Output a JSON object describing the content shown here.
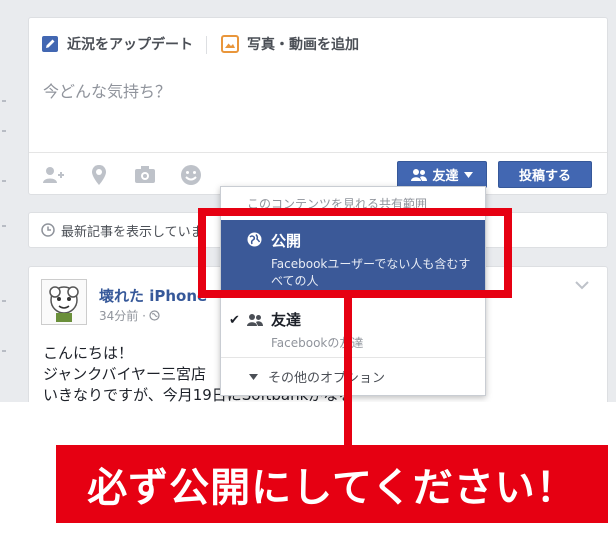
{
  "composer": {
    "tab_status": "近況をアップデート",
    "tab_photo": "写真・動画を追加",
    "placeholder": "今どんな気持ち？",
    "friends_button": "友達",
    "post_button": "投稿する"
  },
  "news_bar": {
    "text": "最新記事を表示していま"
  },
  "post": {
    "author": "壊れた iPhone・",
    "time": "34分前 ·",
    "lines": [
      "こんにちは！",
      "ジャンクバイヤー三宮店",
      "いきなりですが、今月19日にSoftbankがなる"
    ]
  },
  "dropdown": {
    "header": "このコンテンツを見れる共有範囲",
    "public_title": "公開",
    "public_desc": "Facebookユーザーでない人も含むすべての人",
    "check": "✔",
    "friends_title": "友達",
    "friends_desc": "Facebookの友達",
    "more": "その他のオプション"
  },
  "banner": {
    "text": "必ず公開にしてください！"
  },
  "colors": {
    "fb_blue": "#4267b2",
    "annotation_red": "#e60012"
  }
}
